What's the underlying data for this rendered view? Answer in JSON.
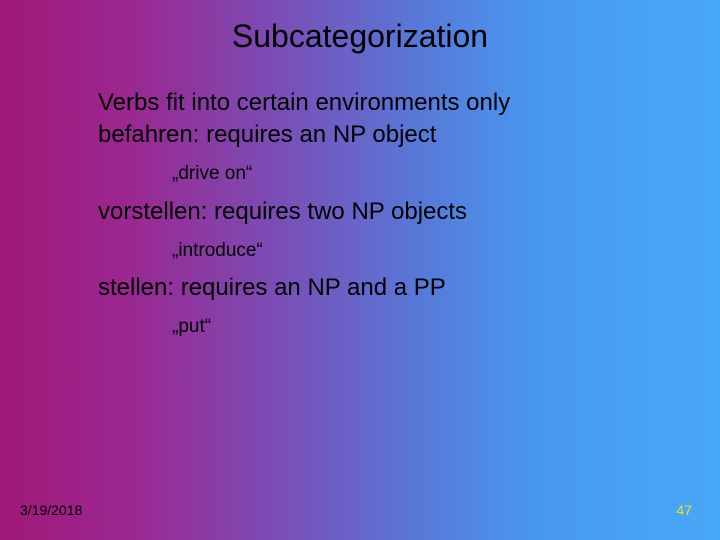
{
  "title": "Subcategorization",
  "body": {
    "intro": "Verbs fit into certain environments only",
    "items": [
      {
        "main": "befahren: requires an NP object",
        "gloss": "„drive on“"
      },
      {
        "main": "vorstellen: requires two NP objects",
        "gloss": "„introduce“"
      },
      {
        "main": "stellen: requires an NP and a PP",
        "gloss": "„put“"
      }
    ]
  },
  "footer": {
    "date": "3/19/2018",
    "page": "47"
  }
}
